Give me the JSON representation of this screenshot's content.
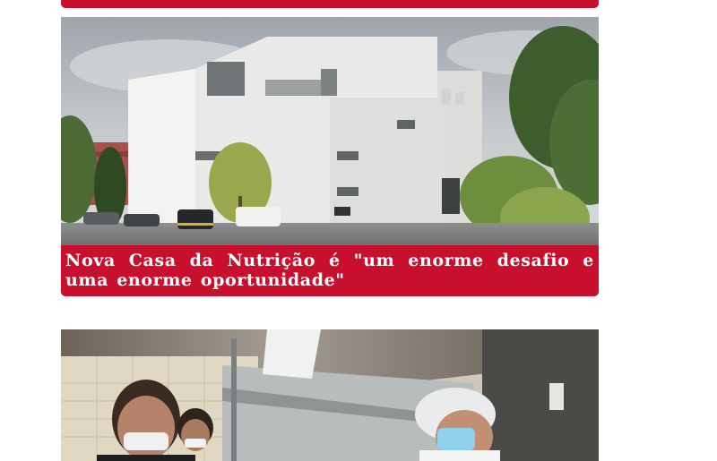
{
  "articles": [
    {
      "headline": "",
      "image": "previous-article-image"
    },
    {
      "headline": "Nova Casa da Nutrição é \"um enorme desafio e uma enorme oportunidade\"",
      "image": "white-faculty-building-photo"
    },
    {
      "headline": "",
      "image": "people-in-cafeteria-kitchen-photo"
    }
  ],
  "colors": {
    "accent": "#c8102e",
    "caption_text": "#ffffff",
    "background": "#ffffff"
  }
}
